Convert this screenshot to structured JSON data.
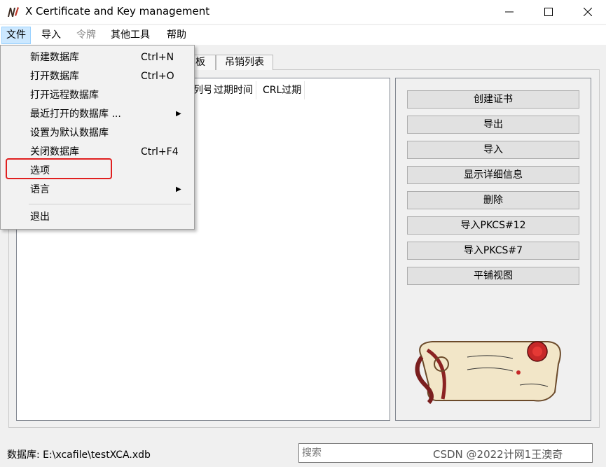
{
  "window": {
    "title": "X Certificate and Key management"
  },
  "menubar": {
    "items": [
      {
        "label": "文件",
        "state": "active"
      },
      {
        "label": "导入",
        "state": "normal"
      },
      {
        "label": "令牌",
        "state": "disabled"
      },
      {
        "label": "其他工具",
        "state": "normal"
      },
      {
        "label": "帮助",
        "state": "normal"
      }
    ]
  },
  "file_menu": {
    "items": [
      {
        "label": "新建数据库",
        "shortcut": "Ctrl+N"
      },
      {
        "label": "打开数据库",
        "shortcut": "Ctrl+O"
      },
      {
        "label": "打开远程数据库",
        "shortcut": ""
      },
      {
        "label": "最近打开的数据库 ...",
        "shortcut": "",
        "submenu": true
      },
      {
        "label": "设置为默认数据库",
        "shortcut": ""
      },
      {
        "label": "关闭数据库",
        "shortcut": "Ctrl+F4"
      },
      {
        "label": "选项",
        "shortcut": "",
        "highlighted": true
      },
      {
        "label": "语言",
        "shortcut": "",
        "submenu": true
      },
      {
        "label": "退出",
        "shortcut": ""
      }
    ]
  },
  "tabs": [
    {
      "label": "板"
    },
    {
      "label": "吊销列表"
    }
  ],
  "list_columns": [
    "列号",
    "过期时间",
    "CRL过期"
  ],
  "actions": [
    {
      "label": "创建证书"
    },
    {
      "label": "导出"
    },
    {
      "label": "导入"
    },
    {
      "label": "显示详细信息"
    },
    {
      "label": "删除"
    },
    {
      "label": "导入PKCS#12"
    },
    {
      "label": "导入PKCS#7"
    },
    {
      "label": "平铺视图"
    }
  ],
  "status": {
    "database_label": "数据库: E:\\xcafile\\testXCA.xdb"
  },
  "search": {
    "placeholder": "搜索"
  },
  "watermark": "CSDN @2022计网1王澳奇",
  "colors": {
    "menu_active_bg": "#cce8ff",
    "highlight_box": "#e02020",
    "button_bg": "#e1e1e1"
  }
}
